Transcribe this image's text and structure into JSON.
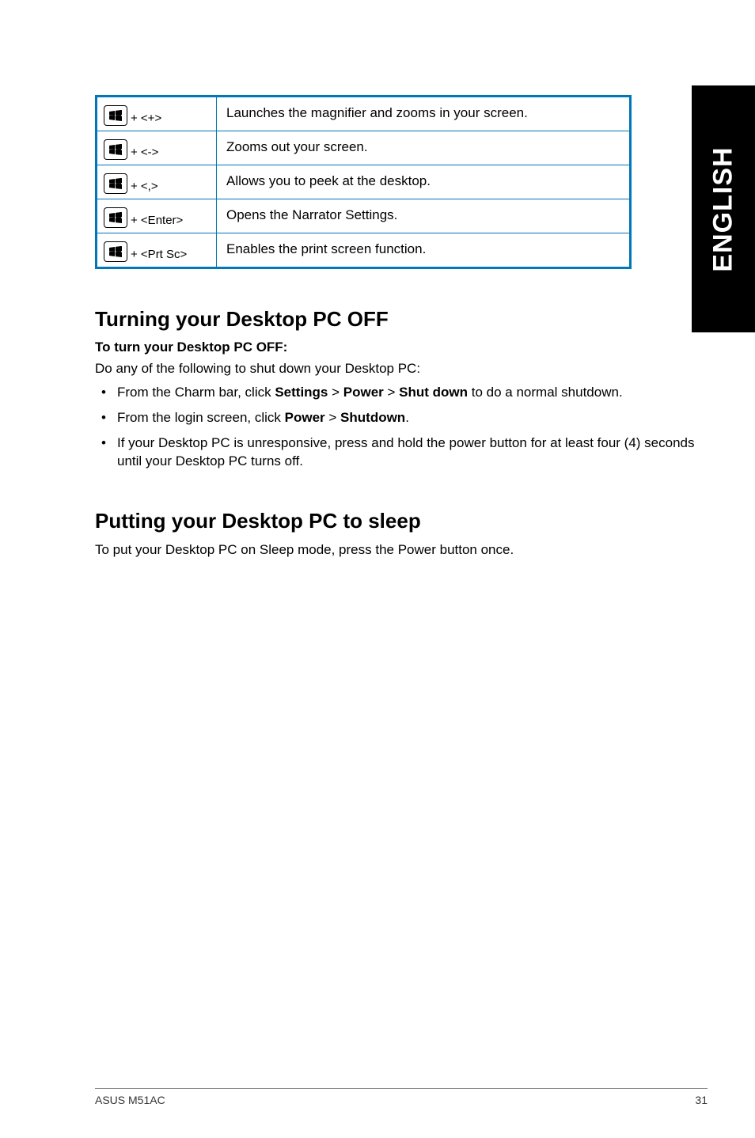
{
  "sideTab": "ENGLISH",
  "shortcuts": [
    {
      "key": "+ <+>",
      "desc": "Launches the magnifier and zooms in your screen."
    },
    {
      "key": "+ <->",
      "desc": "Zooms out your screen."
    },
    {
      "key": "+ <,>",
      "desc": "Allows you to peek at the desktop."
    },
    {
      "key": "+ <Enter>",
      "desc": "Opens the Narrator Settings."
    },
    {
      "key": "+ <Prt Sc>",
      "desc": "Enables the print screen function."
    }
  ],
  "section1": {
    "title": "Turning your Desktop PC OFF",
    "sub": "To turn your Desktop PC OFF:",
    "intro": "Do any of the following to shut down your Desktop PC:",
    "items": [
      {
        "pre": "From the Charm bar, click ",
        "b1": "Settings",
        "mid1": " > ",
        "b2": "Power",
        "mid2": " > ",
        "b3": "Shut down",
        "post": " to do a normal shutdown."
      },
      {
        "pre": "From the login screen, click ",
        "b1": "Power",
        "mid1": " > ",
        "b2": "Shutdown",
        "post": "."
      },
      {
        "plain": "If your Desktop PC is unresponsive, press and hold the power  button for at least four (4) seconds until your Desktop PC turns off."
      }
    ]
  },
  "section2": {
    "title": "Putting your Desktop PC to sleep",
    "body": "To put your Desktop PC on Sleep mode, press the Power button once."
  },
  "footer": {
    "left": "ASUS M51AC",
    "right": "31"
  }
}
